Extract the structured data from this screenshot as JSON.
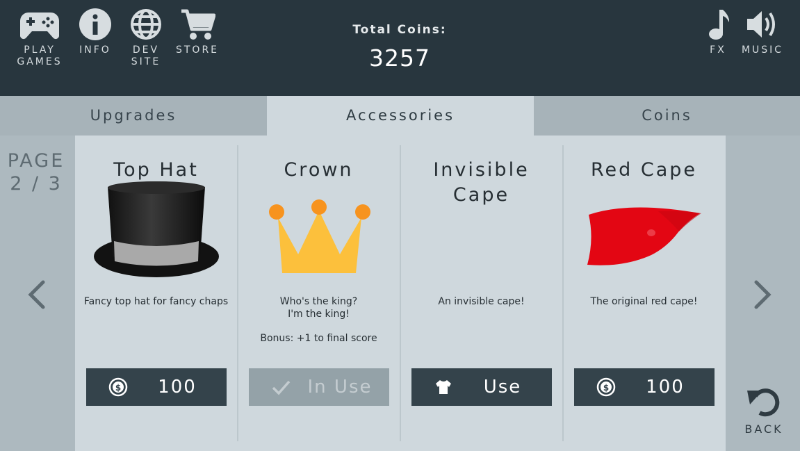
{
  "header": {
    "nav": [
      {
        "label": "PLAY\nGAMES",
        "icon": "gamepad-icon"
      },
      {
        "label": "INFO",
        "icon": "info-icon"
      },
      {
        "label": "DEV\nSITE",
        "icon": "globe-icon"
      },
      {
        "label": "STORE",
        "icon": "cart-icon"
      },
      {
        "label": "FX",
        "icon": "music-note-icon"
      },
      {
        "label": "MUSIC",
        "icon": "speaker-icon"
      }
    ],
    "coins_title": "Total Coins:",
    "coins_value": "3257"
  },
  "tabs": [
    "Upgrades",
    "Accessories",
    "Coins"
  ],
  "active_tab": "Accessories",
  "page": {
    "label": "PAGE",
    "indicator": "2 / 3"
  },
  "back_label": "BACK",
  "items": [
    {
      "title": "Top Hat",
      "desc": "Fancy top hat for fancy chaps",
      "bonus": "",
      "button": "100",
      "button_icon": "coin-icon",
      "state": "buy"
    },
    {
      "title": "Crown",
      "desc": "Who's the king?\nI'm the king!",
      "bonus": "Bonus: +1 to final score",
      "button": "In Use",
      "button_icon": "check-icon",
      "state": "in-use"
    },
    {
      "title": "Invisible Cape",
      "desc": "An invisible cape!",
      "bonus": "",
      "button": "Use",
      "button_icon": "shirt-icon",
      "state": "use"
    },
    {
      "title": "Red Cape",
      "desc": "The original red cape!",
      "bonus": "",
      "button": "100",
      "button_icon": "coin-icon",
      "state": "buy"
    }
  ],
  "colors": {
    "header_bg": "#28363e",
    "button_bg": "#34434b",
    "crown": "#fcc03c",
    "crown_orbs": "#f7931e",
    "cape": "#e30613"
  }
}
